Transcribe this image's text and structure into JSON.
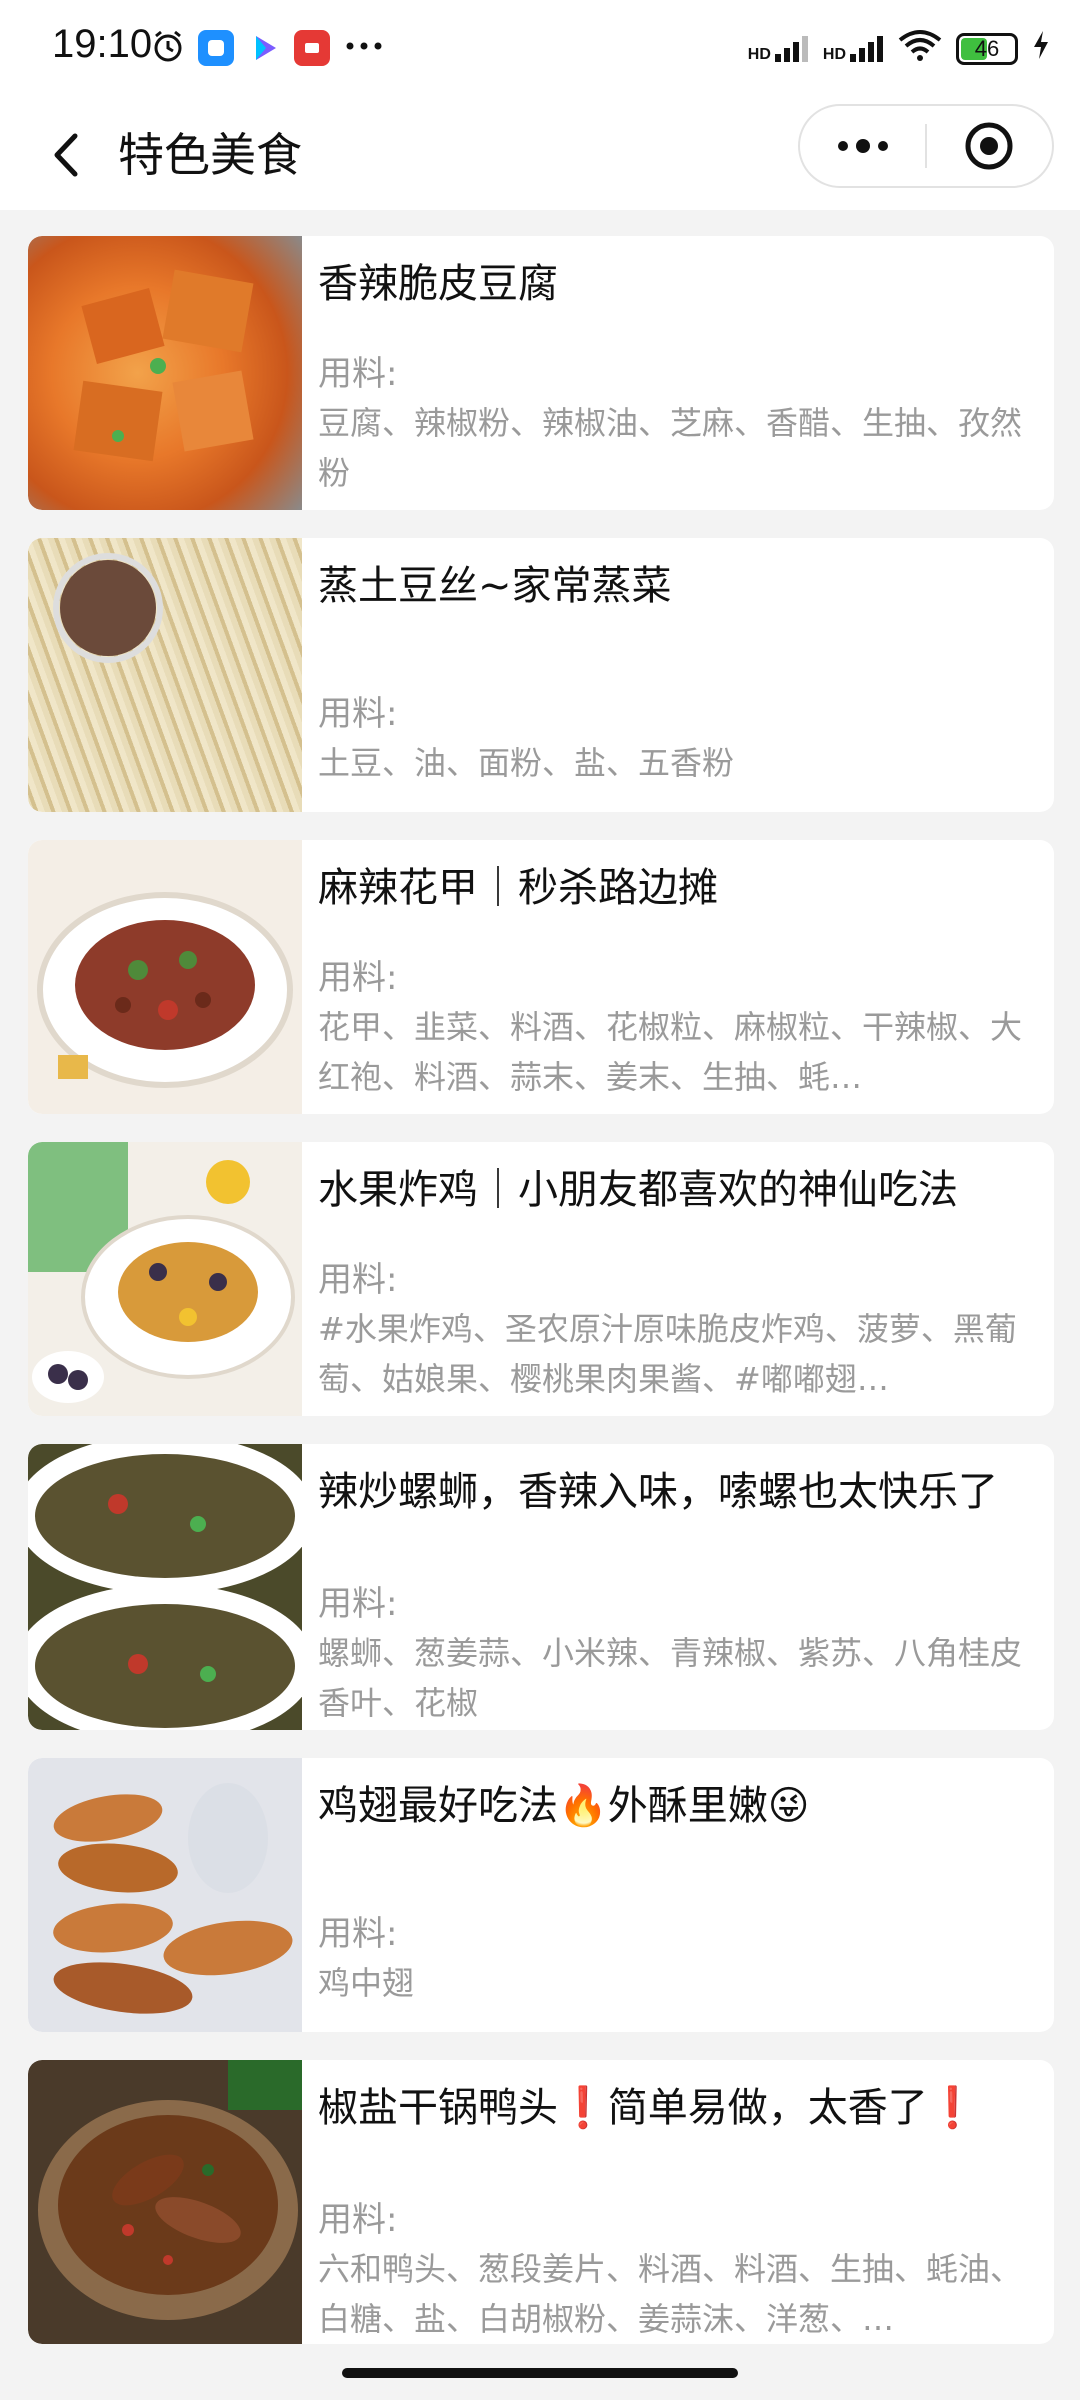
{
  "status_bar": {
    "time": "19:10",
    "network_1": "HD",
    "network_2": "HD",
    "battery": "46",
    "icons": [
      "alarm-icon",
      "app-icon-blue",
      "app-icon-video",
      "app-icon-red",
      "more-dots-icon",
      "signal-icon",
      "wifi-icon",
      "charging-icon"
    ]
  },
  "nav": {
    "title": "特色美食"
  },
  "ingredients_label": "用料:",
  "recipes": [
    {
      "title": "香辣脆皮豆腐",
      "ingredients": "豆腐、辣椒粉、辣椒油、芝麻、香醋、生抽、孜然粉"
    },
    {
      "title": "蒸土豆丝~家常蒸菜",
      "ingredients": "土豆、油、面粉、盐、五香粉"
    },
    {
      "title": "麻辣花甲｜秒杀路边摊",
      "ingredients": "花甲、韭菜、料酒、花椒粒、麻椒粒、干辣椒、大红袍、料酒、蒜末、姜末、生抽、蚝…"
    },
    {
      "title": "水果炸鸡｜小朋友都喜欢的神仙吃法",
      "ingredients": "#水果炸鸡、圣农原汁原味脆皮炸鸡、菠萝、黑葡萄、姑娘果、樱桃果肉果酱、#嘟嘟翅…"
    },
    {
      "title": "辣炒螺蛳，香辣入味，嗦螺也太快乐了",
      "ingredients": "螺蛳、葱姜蒜、小米辣、青辣椒、紫苏、八角桂皮香叶、花椒"
    },
    {
      "title": "鸡翅最好吃法🔥外酥里嫩😜",
      "ingredients": "鸡中翅"
    },
    {
      "title": "椒盐干锅鸭头❗简单易做，太香了❗",
      "ingredients": "六和鸭头、葱段姜片、料酒、料酒、生抽、蚝油、白糖、盐、白胡椒粉、姜蒜沫、洋葱、…"
    }
  ],
  "thumb_colors": [
    [
      "#e8782a",
      "#c9561b",
      "#f2a24a"
    ],
    [
      "#e8dcb8",
      "#d4c08e",
      "#6b4a3a"
    ],
    [
      "#f4eee6",
      "#8e3b2a",
      "#4f8a3a"
    ],
    [
      "#f3efe8",
      "#d89a3a",
      "#3a2f4a"
    ],
    [
      "#4b4a2a",
      "#8a5a2a",
      "#c0392b"
    ],
    [
      "#e2e4ea",
      "#c97a3a",
      "#a85a2a"
    ],
    [
      "#4a3a2a",
      "#7a3a1a",
      "#2a6a2a"
    ]
  ]
}
